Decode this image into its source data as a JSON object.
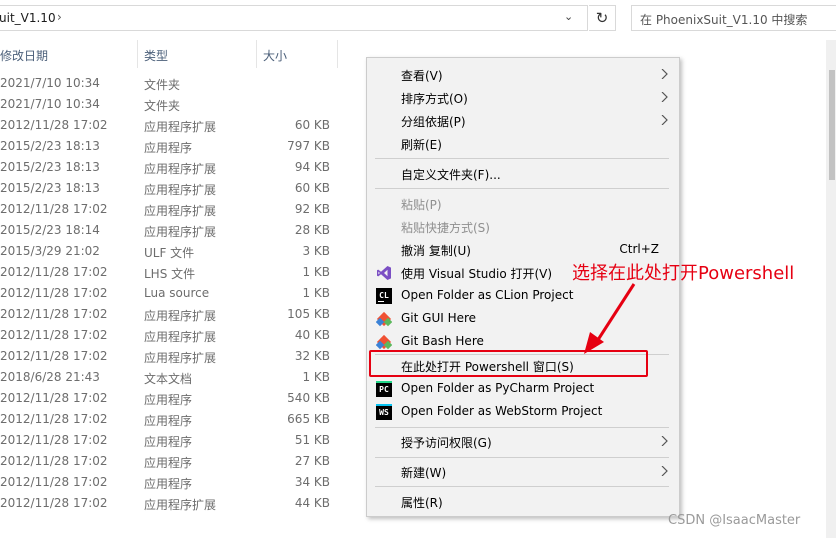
{
  "address_bar": {
    "path_text": "uit_V1.10",
    "separator": "›",
    "dropdown": "⌄",
    "refresh": "↻"
  },
  "search": {
    "placeholder": "在 PhoenixSuit_V1.10 中搜索"
  },
  "columns": {
    "date": "修改日期",
    "type": "类型",
    "size": "大小"
  },
  "files": [
    {
      "date": "2021/7/10 10:34",
      "type": "文件夹",
      "size": ""
    },
    {
      "date": "2021/7/10 10:34",
      "type": "文件夹",
      "size": ""
    },
    {
      "date": "2012/11/28 17:02",
      "type": "应用程序扩展",
      "size": "60 KB"
    },
    {
      "date": "2015/2/23 18:13",
      "type": "应用程序",
      "size": "797 KB"
    },
    {
      "date": "2015/2/23 18:13",
      "type": "应用程序扩展",
      "size": "94 KB"
    },
    {
      "date": "2015/2/23 18:13",
      "type": "应用程序扩展",
      "size": "60 KB"
    },
    {
      "date": "2012/11/28 17:02",
      "type": "应用程序扩展",
      "size": "92 KB"
    },
    {
      "date": "2015/2/23 18:14",
      "type": "应用程序扩展",
      "size": "28 KB"
    },
    {
      "date": "2015/3/29 21:02",
      "type": "ULF 文件",
      "size": "3 KB"
    },
    {
      "date": "2012/11/28 17:02",
      "type": "LHS 文件",
      "size": "1 KB"
    },
    {
      "date": "2012/11/28 17:02",
      "type": "Lua source",
      "size": "1 KB"
    },
    {
      "date": "2012/11/28 17:02",
      "type": "应用程序扩展",
      "size": "105 KB"
    },
    {
      "date": "2012/11/28 17:02",
      "type": "应用程序扩展",
      "size": "40 KB"
    },
    {
      "date": "2012/11/28 17:02",
      "type": "应用程序扩展",
      "size": "32 KB"
    },
    {
      "date": "2018/6/28 21:43",
      "type": "文本文档",
      "size": "1 KB"
    },
    {
      "date": "2012/11/28 17:02",
      "type": "应用程序",
      "size": "540 KB"
    },
    {
      "date": "2012/11/28 17:02",
      "type": "应用程序",
      "size": "665 KB"
    },
    {
      "date": "2012/11/28 17:02",
      "type": "应用程序",
      "size": "51 KB"
    },
    {
      "date": "2012/11/28 17:02",
      "type": "应用程序",
      "size": "27 KB"
    },
    {
      "date": "2012/11/28 17:02",
      "type": "应用程序",
      "size": "34 KB"
    },
    {
      "date": "2012/11/28 17:02",
      "type": "应用程序扩展",
      "size": "44 KB"
    }
  ],
  "context_menu": {
    "view": "查看(V)",
    "sort_by": "排序方式(O)",
    "group_by": "分组依据(P)",
    "refresh": "刷新(E)",
    "customize_folder": "自定义文件夹(F)...",
    "paste": "粘贴(P)",
    "paste_shortcut": "粘贴快捷方式(S)",
    "undo_copy": "撤消 复制(U)",
    "undo_copy_shortcut": "Ctrl+Z",
    "open_visual_studio": "使用 Visual Studio 打开(V)",
    "open_clion": "Open Folder as CLion Project",
    "git_gui": "Git GUI Here",
    "git_bash": "Git Bash Here",
    "open_powershell": "在此处打开 Powershell 窗口(S)",
    "open_pycharm": "Open Folder as PyCharm Project",
    "open_webstorm": "Open Folder as WebStorm Project",
    "grant_access": "授予访问权限(G)",
    "new": "新建(W)",
    "properties": "属性(R)",
    "icon_text": {
      "clion": "CL",
      "pycharm": "PC",
      "webstorm": "WS"
    }
  },
  "annotation": {
    "text": "选择在此处打开Powershell"
  },
  "watermark": "CSDN @IsaacMaster",
  "colors": {
    "highlight": "#e60012",
    "menu_bg": "#f2f2f2",
    "header_text": "#4c607a"
  }
}
